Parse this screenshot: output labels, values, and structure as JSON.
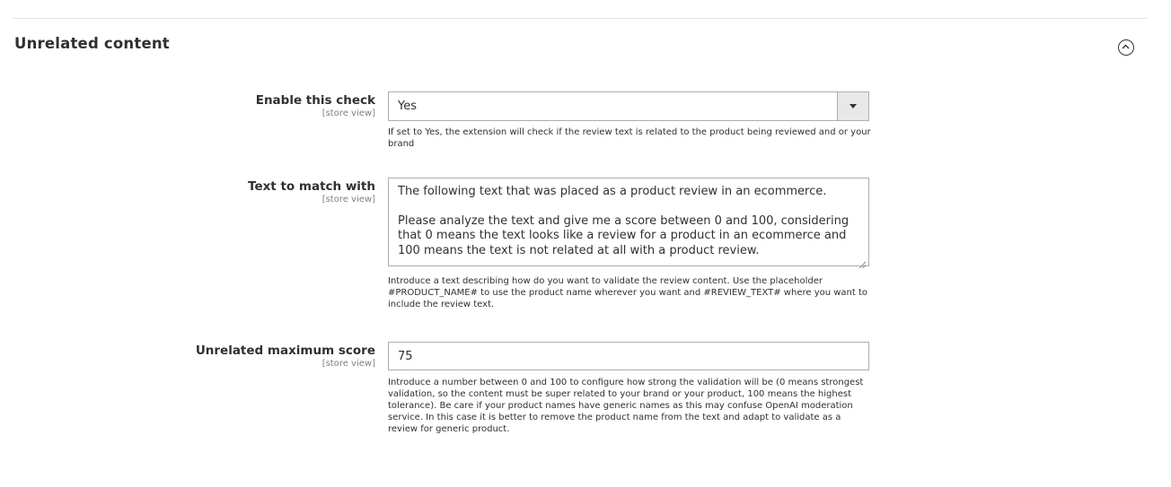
{
  "section": {
    "title": "Unrelated content"
  },
  "fields": {
    "enable_check": {
      "label": "Enable this check",
      "scope": "[store view]",
      "value": "Yes",
      "note": "If set to Yes, the extension will check if the review text is related to the product being reviewed and or your brand"
    },
    "text_to_match": {
      "label": "Text to match with",
      "scope": "[store view]",
      "paragraph1": "The following text that was placed as a product review in an ecommerce.",
      "paragraph2": "Please analyze the text and give me a score between 0 and 100, considering that 0 means the text looks like a review for a product in an ecommerce and 100 means the text is not related at all with a product review.",
      "note": "Introduce a text describing how do you want to validate the review content. Use the placeholder #PRODUCT_NAME# to use the product name wherever you want and #REVIEW_TEXT# where you want to include the review text."
    },
    "max_score": {
      "label": "Unrelated maximum score",
      "scope": "[store view]",
      "value": "75",
      "note": "Introduce a number between 0 and 100 to configure how strong the validation will be (0 means strongest validation, so the content must be super related to your brand or your product, 100 means the highest tolerance). Be care if your product names have generic names as this may confuse OpenAI moderation service. In this case it is better to remove the product name from the text and adapt to validate as a review for generic product."
    }
  },
  "icons": {
    "collapse": "chevron-up-circle-icon",
    "dropdown": "triangle-down-icon",
    "resize": "resize-grip-icon"
  }
}
